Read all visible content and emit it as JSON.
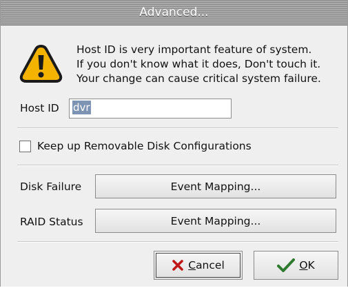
{
  "window": {
    "title": "Advanced..."
  },
  "warning": {
    "icon": "warning-icon",
    "lines": [
      "Host ID is very important feature of system.",
      "If you don't know what it does, Don't touch it.",
      "Your change can cause critical system failure."
    ]
  },
  "host_id": {
    "label": "Host ID",
    "value": "dvr"
  },
  "removable_disk": {
    "label": "Keep up Removable Disk Configurations",
    "checked": false
  },
  "disk_failure": {
    "label": "Disk Failure",
    "button_label": "Event Mapping..."
  },
  "raid_status": {
    "label": "RAID Status",
    "button_label": "Event Mapping..."
  },
  "buttons": {
    "cancel": {
      "mnemonic": "C",
      "rest": "ancel",
      "icon": "red-x-icon"
    },
    "ok": {
      "mnemonic": "O",
      "rest": "K",
      "icon": "checkmark-icon"
    }
  },
  "colors": {
    "warning_fill": "#f4b300",
    "cancel_icon": "#c01818",
    "ok_icon": "#2e7a2e",
    "selection": "#7d93b4"
  }
}
